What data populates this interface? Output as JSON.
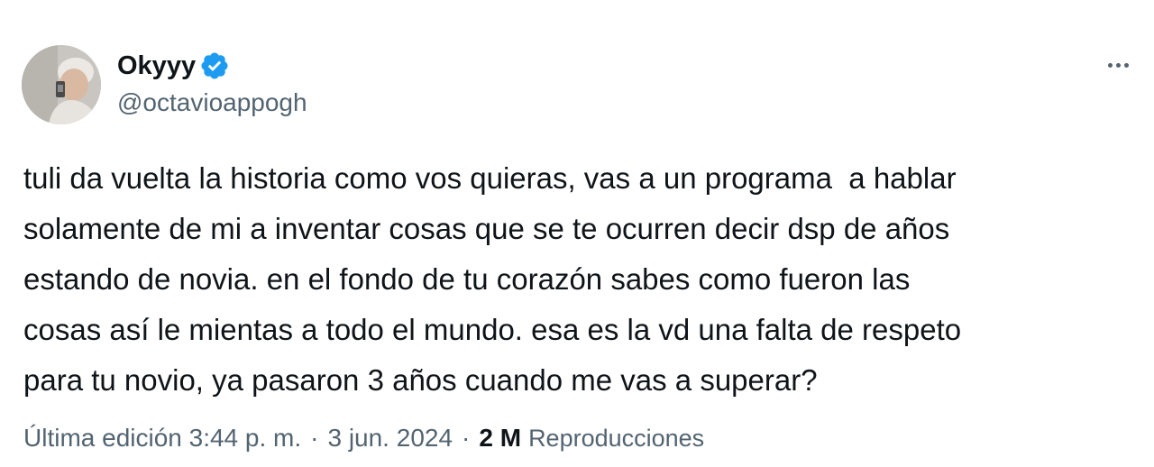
{
  "tweet": {
    "author": {
      "display_name": "Okyyy",
      "handle": "@octavioappogh",
      "verified": true,
      "verified_color": "#1d9bf0"
    },
    "text_lines": [
      "tuli da vuelta la historia como vos quieras, vas a un programa  a hablar",
      "solamente de mi a inventar cosas que se te ocurren decir dsp de años",
      "estando de novia. en el fondo de tu corazón sabes como fueron las",
      "cosas así le mientas a todo el mundo. esa es la vd una falta de respeto",
      "para tu novio, ya pasaron 3 años cuando me vas a superar?"
    ],
    "meta": {
      "edited_label": "Última edición 3:44 p. m.",
      "separator": "·",
      "date": "3 jun. 2024",
      "views_count": "2 M",
      "views_label": "Reproducciones"
    },
    "more_icon": "more-horizontal-icon"
  }
}
